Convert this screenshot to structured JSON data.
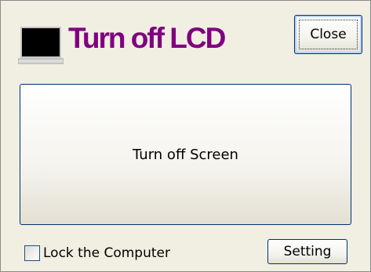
{
  "window": {
    "app_title": "Turn off LCD",
    "close_label": "Close"
  },
  "main": {
    "turn_off_label": "Turn off Screen"
  },
  "footer": {
    "lock_label": "Lock the Computer",
    "lock_checked": false,
    "setting_label": "Setting"
  },
  "icons": {
    "app_icon": "laptop-lcd-icon"
  },
  "colors": {
    "title": "#800080",
    "background": "#f1efe2",
    "button_border": "#00306e"
  }
}
